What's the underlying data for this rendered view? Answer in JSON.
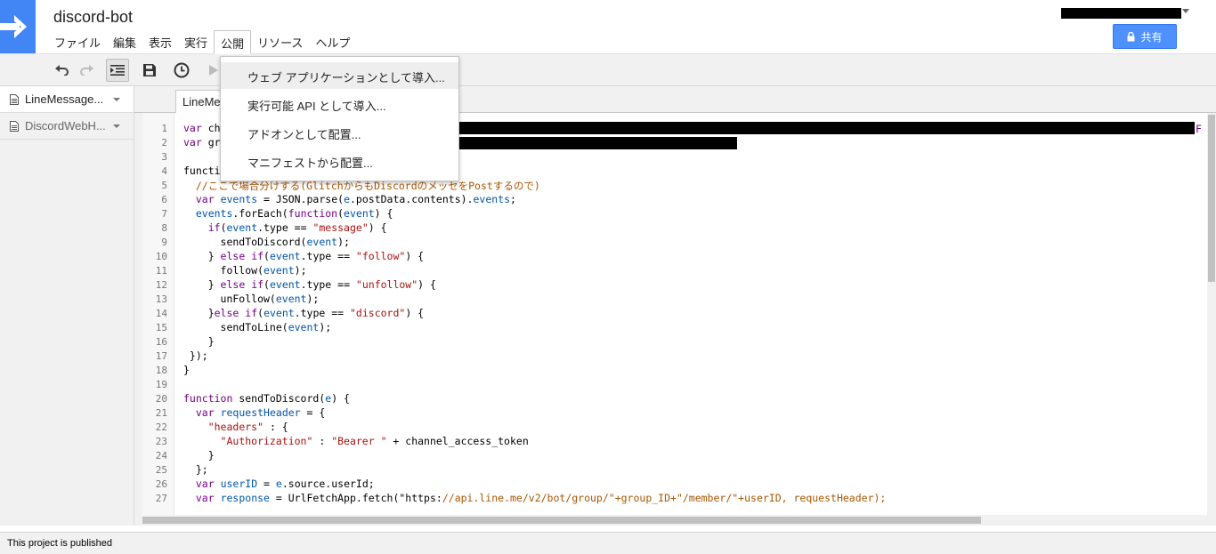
{
  "app": {
    "title": "discord-bot"
  },
  "menu": {
    "items": [
      "ファイル",
      "編集",
      "表示",
      "実行",
      "公開",
      "リソース",
      "ヘルプ"
    ],
    "active_index": 4
  },
  "share": {
    "label": "共有"
  },
  "publish_dropdown": {
    "items": [
      "ウェブ アプリケーションとして導入...",
      "実行可能 API として導入...",
      "アドオンとして配置...",
      "マニフェストから配置..."
    ],
    "hovered_index": 0
  },
  "sidebar": {
    "files": [
      {
        "name": "LineMessage..."
      },
      {
        "name": "DiscordWebH..."
      }
    ]
  },
  "editor": {
    "active_tab": "LineMe",
    "line_numbers": [
      "1",
      "2",
      "3",
      "4",
      "5",
      "6",
      "7",
      "8",
      "9",
      "10",
      "11",
      "12",
      "13",
      "14",
      "15",
      "16",
      "17",
      "18",
      "19",
      "20",
      "21",
      "22",
      "23",
      "24",
      "25",
      "26",
      "27"
    ],
    "lines": [
      "var ch",
      "var gr",
      "",
      "functi",
      "  //ここで場合分けする(GlitchからもDiscordのメッセをPostするので)",
      "  var events = JSON.parse(e.postData.contents).events;",
      "  events.forEach(function(event) {",
      "    if(event.type == \"message\") {",
      "      sendToDiscord(event);",
      "    } else if(event.type == \"follow\") {",
      "      follow(event);",
      "    } else if(event.type == \"unfollow\") {",
      "      unFollow(event);",
      "    }else if(event.type == \"discord\") {",
      "      sendToLine(event);",
      "    }",
      " });",
      "}",
      "",
      "function sendToDiscord(e) {",
      "  var requestHeader = {",
      "    \"headers\" : {",
      "      \"Authorization\" : \"Bearer \" + channel_access_token",
      "    }",
      "  };",
      "  var userID = e.source.userId;",
      "  var response = UrlFetchApp.fetch(\"https://api.line.me/v2/bot/group/\"+group_ID+\"/member/\"+userID, requestHeader);"
    ],
    "line1_trailing": "F"
  },
  "status": {
    "text": "This project is published"
  },
  "colors": {
    "brand_blue": "#4285f4",
    "share_blue": "#4d90fe",
    "keyword": "#770088",
    "string": "#aa1111",
    "comment": "#aa5500",
    "variable": "#0055aa"
  },
  "icons": [
    "arrow-right-logo-icon",
    "undo-icon",
    "redo-icon",
    "indent-icon",
    "save-icon",
    "triggers-clock-icon",
    "run-icon",
    "lock-icon",
    "document-icon",
    "chevron-down-icon"
  ]
}
